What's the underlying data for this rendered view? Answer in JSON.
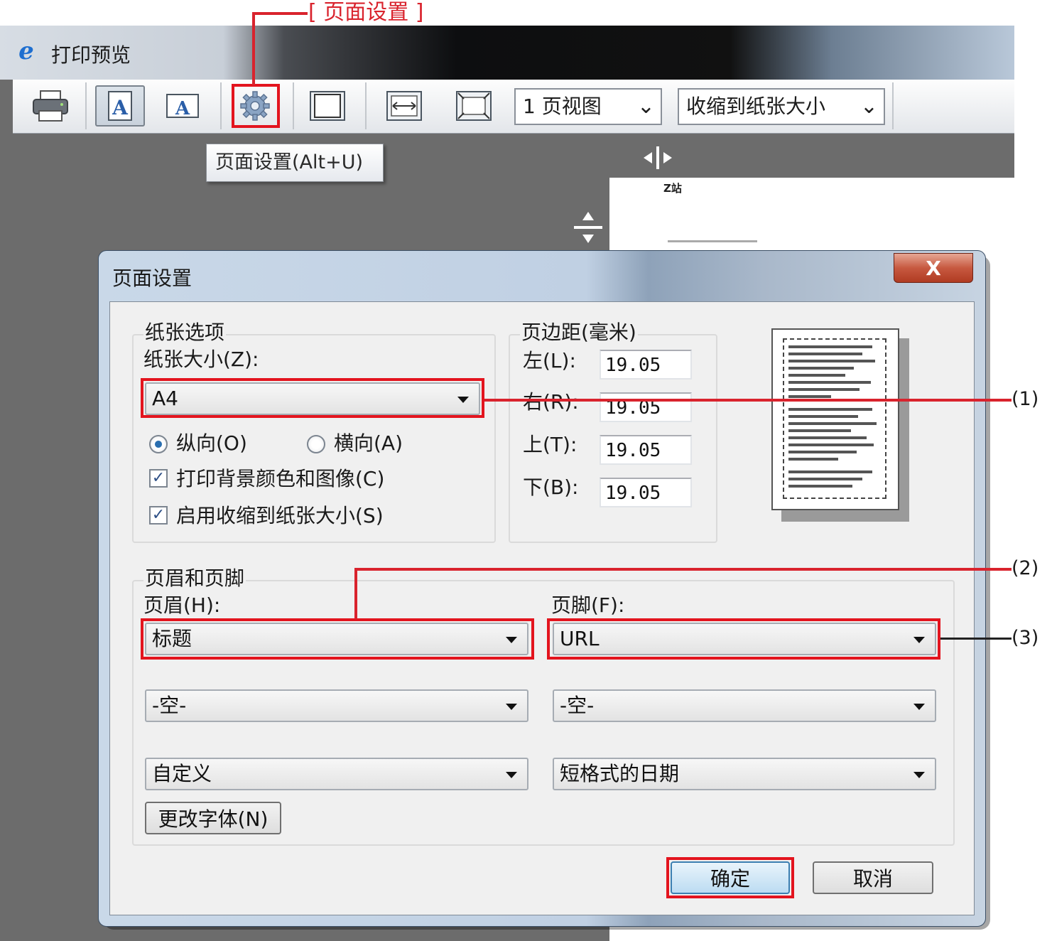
{
  "annotations": {
    "page_setup_label": "[ 页面设置 ]",
    "callout_1": "(1)",
    "callout_2": "(2)",
    "callout_3": "(3)"
  },
  "window": {
    "title": "打印预览",
    "toolbar": {
      "view_select": "1 页视图",
      "shrink_select": "收缩到纸张大小",
      "tooltip": "页面设置(Alt+U)"
    },
    "preview_header": "Z站"
  },
  "dialog": {
    "title": "页面设置",
    "close_label": "X",
    "paper": {
      "group_title": "纸张选项",
      "size_label": "纸张大小(Z):",
      "size_value": "A4",
      "portrait_label": "纵向(O)",
      "landscape_label": "横向(A)",
      "orientation": "portrait",
      "print_background_label": "打印背景颜色和图像(C)",
      "shrink_label": "启用收缩到纸张大小(S)"
    },
    "margins": {
      "group_title": "页边距(毫米)",
      "left_label": "左(L):",
      "left_value": "19.05",
      "right_label": "右(R):",
      "right_value": "19.05",
      "top_label": "上(T):",
      "top_value": "19.05",
      "bottom_label": "下(B):",
      "bottom_value": "19.05"
    },
    "header_footer": {
      "group_title": "页眉和页脚",
      "header_label": "页眉(H):",
      "footer_label": "页脚(F):",
      "header_1": "标题",
      "header_2": "-空-",
      "header_3": "自定义",
      "footer_1": "URL",
      "footer_2": "-空-",
      "footer_3": "短格式的日期",
      "change_font": "更改字体(N)"
    },
    "ok": "确定",
    "cancel": "取消"
  },
  "colors": {
    "annotation_red": "#e3141e",
    "dialog_frame": "#c0d0e3",
    "close_button": "#c75940"
  }
}
